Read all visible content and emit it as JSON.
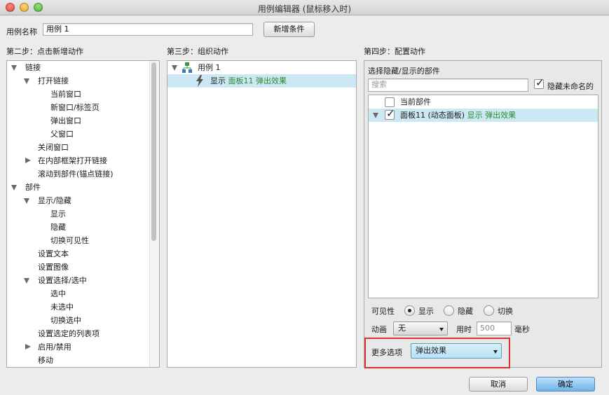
{
  "window": {
    "title": "用例编辑器 (鼠标移入时)"
  },
  "case_name": {
    "label": "用例名称",
    "value": "用例 1",
    "add_condition": "新增条件"
  },
  "step2": {
    "title": "第二步：点击新增动作",
    "items": [
      {
        "label": "链接"
      },
      {
        "label": "打开链接"
      },
      {
        "label": "当前窗口"
      },
      {
        "label": "新窗口/标签页"
      },
      {
        "label": "弹出窗口"
      },
      {
        "label": "父窗口"
      },
      {
        "label": "关闭窗口"
      },
      {
        "label": "在内部框架打开链接"
      },
      {
        "label": "滚动到部件(锚点链接)"
      },
      {
        "label": "部件"
      },
      {
        "label": "显示/隐藏"
      },
      {
        "label": "显示"
      },
      {
        "label": "隐藏"
      },
      {
        "label": "切换可见性"
      },
      {
        "label": "设置文本"
      },
      {
        "label": "设置图像"
      },
      {
        "label": "设置选择/选中"
      },
      {
        "label": "选中"
      },
      {
        "label": "未选中"
      },
      {
        "label": "切换选中"
      },
      {
        "label": "设置选定的列表项"
      },
      {
        "label": "启用/禁用"
      },
      {
        "label": "移动"
      }
    ]
  },
  "step3": {
    "title": "第三步：组织动作",
    "case": "用例 1",
    "action_verb": "显示",
    "action_detail": "面板11 弹出效果"
  },
  "step4": {
    "title": "第四步：配置动作",
    "choose_label": "选择隐藏/显示的部件",
    "search_placeholder": "搜索",
    "hide_unnamed": "隐藏未命名的",
    "widgets": [
      {
        "label": "当前部件",
        "detail": ""
      },
      {
        "label": "面板11 (动态面板)",
        "detail": "显示 弹出效果"
      }
    ],
    "visibility": {
      "label": "可见性",
      "options": [
        "显示",
        "隐藏",
        "切换"
      ],
      "selected": "显示"
    },
    "animation": {
      "label": "动画",
      "value": "无",
      "duration_label": "用时",
      "duration_value": "500",
      "unit": "毫秒"
    },
    "more": {
      "label": "更多选项",
      "value": "弹出效果"
    }
  },
  "footer": {
    "cancel": "取消",
    "ok": "确定"
  },
  "colors": {
    "selection": "#cce8f4",
    "accent": "#e03030",
    "green_text": "#2a8a2a"
  }
}
